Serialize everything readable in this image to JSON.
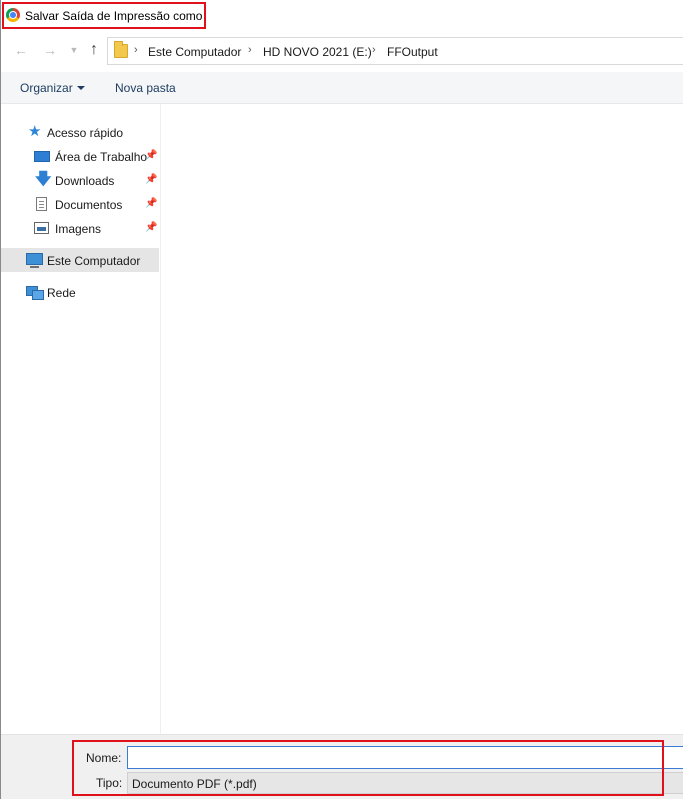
{
  "window": {
    "title": "Salvar Saída de Impressão como"
  },
  "navigation": {
    "back_icon": "arrow-left-icon",
    "forward_icon": "arrow-right-icon",
    "recent_icon": "chevron-down-icon",
    "up_icon": "arrow-up-icon",
    "breadcrumb": [
      "Este Computador",
      "HD NOVO 2021 (E:)",
      "FFOutput"
    ]
  },
  "toolbar": {
    "organize_label": "Organizar",
    "new_folder_label": "Nova pasta"
  },
  "sidebar": {
    "quick_access": {
      "label": "Acesso rápido",
      "icon": "star-icon",
      "items": [
        {
          "label": "Área de Trabalho",
          "icon": "desktop-icon",
          "pinned": true
        },
        {
          "label": "Downloads",
          "icon": "download-icon",
          "pinned": true
        },
        {
          "label": "Documentos",
          "icon": "document-icon",
          "pinned": true
        },
        {
          "label": "Imagens",
          "icon": "image-icon",
          "pinned": true
        }
      ]
    },
    "this_pc": {
      "label": "Este Computador",
      "icon": "computer-icon",
      "selected": true
    },
    "network": {
      "label": "Rede",
      "icon": "network-icon"
    }
  },
  "form": {
    "name_label": "Nome:",
    "name_value": "",
    "type_label": "Tipo:",
    "type_value": "Documento PDF (*.pdf)"
  },
  "colors": {
    "highlight": "#e0101c",
    "selection": "#e5e5e5",
    "toolbar_text": "#1e3d63"
  }
}
